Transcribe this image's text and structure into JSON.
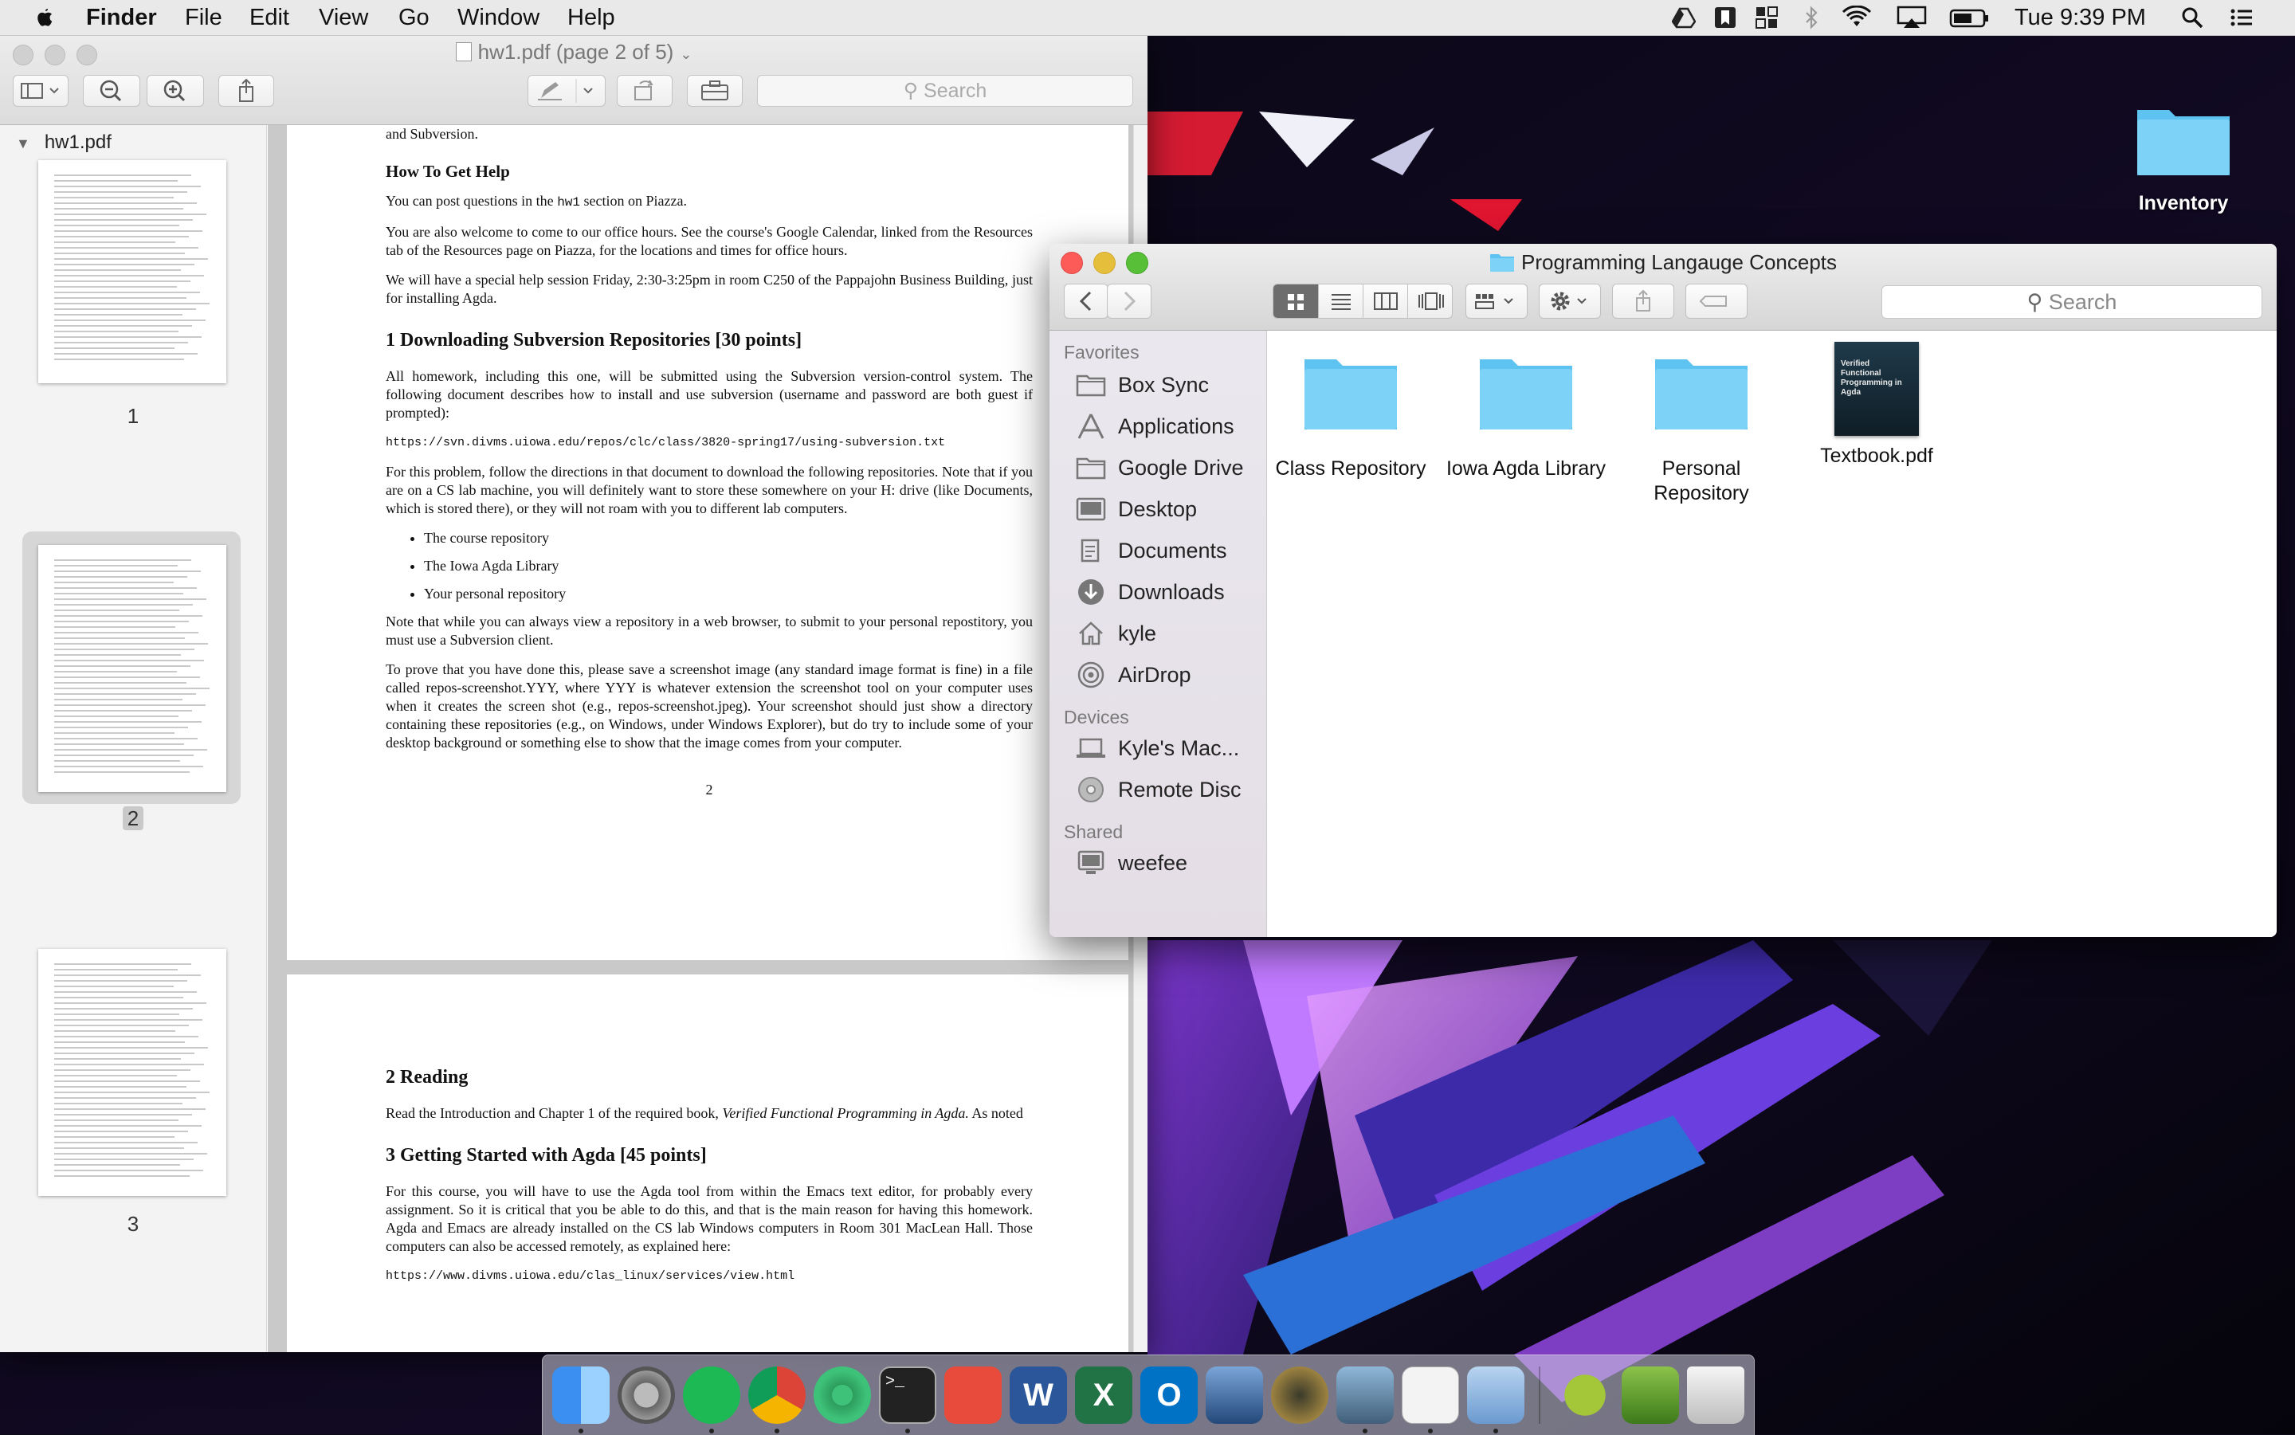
{
  "menubar": {
    "app": "Finder",
    "menus": [
      "File",
      "Edit",
      "View",
      "Go",
      "Window",
      "Help"
    ],
    "clock": "Tue 9:39 PM",
    "status_icons": [
      "google-drive-icon",
      "bookmark-icon",
      "grid-icon",
      "bluetooth-icon",
      "wifi-icon",
      "airplay-icon",
      "battery-icon",
      "spotlight-icon",
      "notification-center-icon"
    ]
  },
  "preview": {
    "title": "hw1.pdf (page 2 of 5)",
    "search_placeholder": "Search",
    "sidebar_doc": "hw1.pdf",
    "page_numbers": [
      "1",
      "2",
      "3"
    ],
    "page2": {
      "top_fragment": "and Subversion.",
      "help_heading": "How To Get Help",
      "help_p1_a": "You can post questions in the ",
      "help_p1_code": "hw1",
      "help_p1_b": " section on Piazza.",
      "help_p2": "You are also welcome to come to our office hours. See the course's Google Calendar, linked from the Resources tab of the Resources page on Piazza, for the locations and times for office hours.",
      "help_p3": "We will have a special help session Friday, 2:30-3:25pm in room C250 of the Pappajohn Business Building, just for installing Agda.",
      "s1_heading": "1   Downloading Subversion Repositories [30 points]",
      "s1_p1": "All homework, including this one, will be submitted using the Subversion version-control system. The following document describes how to install and use subversion (username and password are both guest if prompted):",
      "s1_url": "https://svn.divms.uiowa.edu/repos/clc/class/3820-spring17/using-subversion.txt",
      "s1_p2": "For this problem, follow the directions in that document to download the following repositories. Note that if you are on a CS lab machine, you will definitely want to store these somewhere on your H: drive (like Documents, which is stored there), or they will not roam with you to different lab computers.",
      "s1_bullets": [
        "The course repository",
        "The Iowa Agda Library",
        "Your personal repository"
      ],
      "s1_p3": "Note that while you can always view a repository in a web browser, to submit to your personal repostitory, you must use a Subversion client.",
      "s1_p4": "To prove that you have done this, please save a screenshot image (any standard image format is fine) in a file called repos-screenshot.YYY, where YYY is whatever extension the screenshot tool on your computer uses when it creates the screen shot (e.g., repos-screenshot.jpeg). Your screenshot should just show a directory containing these repositories (e.g., on Windows, under Windows Explorer), but do try to include some of your desktop background or something else to show that the image comes from your computer.",
      "page_no": "2"
    },
    "page3": {
      "s2_heading": "2   Reading",
      "s2_p1_a": "Read the Introduction and Chapter 1 of the required book, ",
      "s2_p1_em": "Verified Functional Programming in Agda.",
      "s2_p1_b": " As noted",
      "s3_heading": "3   Getting Started with Agda [45 points]",
      "s3_p1": "For this course, you will have to use the Agda tool from within the Emacs text editor, for probably every assignment. So it is critical that you be able to do this, and that is the main reason for having this homework. Agda and Emacs are already installed on the CS lab Windows computers in Room 301 MacLean Hall. Those computers can also be accessed remotely, as explained here:",
      "s3_url": "https://www.divms.uiowa.edu/clas_linux/services/view.html"
    }
  },
  "finder": {
    "title": "Programming Langauge Concepts",
    "search_placeholder": "Search",
    "favorites_heading": "Favorites",
    "favorites": [
      {
        "label": "Box Sync",
        "icon": "folder-icon"
      },
      {
        "label": "Applications",
        "icon": "applications-icon"
      },
      {
        "label": "Google Drive",
        "icon": "folder-icon"
      },
      {
        "label": "Desktop",
        "icon": "desktop-icon"
      },
      {
        "label": "Documents",
        "icon": "documents-icon"
      },
      {
        "label": "Downloads",
        "icon": "downloads-icon"
      },
      {
        "label": "kyle",
        "icon": "home-icon"
      },
      {
        "label": "AirDrop",
        "icon": "airdrop-icon"
      }
    ],
    "devices_heading": "Devices",
    "devices": [
      {
        "label": "Kyle's Mac...",
        "icon": "laptop-icon"
      },
      {
        "label": "Remote Disc",
        "icon": "disc-icon"
      }
    ],
    "shared_heading": "Shared",
    "shared": [
      {
        "label": "weefee",
        "icon": "computer-icon"
      }
    ],
    "files": [
      {
        "name": "Class Repository",
        "kind": "folder"
      },
      {
        "name": "Iowa Agda Library",
        "kind": "folder"
      },
      {
        "name": "Personal Repository",
        "kind": "folder"
      },
      {
        "name": "Textbook.pdf",
        "kind": "pdf"
      }
    ],
    "textbook_cover_text": "Verified Functional Programming in Agda"
  },
  "desktop": {
    "icon_label": "Inventory"
  },
  "dock": {
    "apps": [
      "finder-icon",
      "system-preferences-icon",
      "spotify-icon",
      "chrome-icon",
      "atom-icon",
      "terminal-icon",
      "bookmarks-icon",
      "word-icon",
      "excel-icon",
      "outlook-icon",
      "virtualbox-icon",
      "league-of-legends-icon",
      "preview-icon",
      "textedit-icon",
      "xcode-icon",
      "android-studio-icon",
      "ext-icon",
      "trash-icon"
    ]
  }
}
